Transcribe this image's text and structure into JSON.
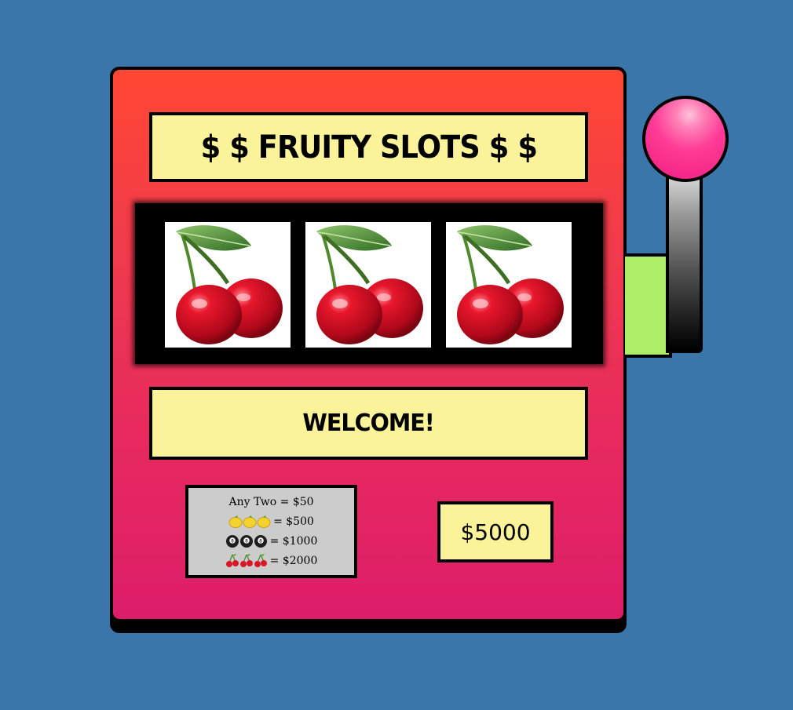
{
  "title": "$ $ FRUITY SLOTS $ $",
  "reels": [
    {
      "symbol": "cherry-icon"
    },
    {
      "symbol": "cherry-icon"
    },
    {
      "symbol": "cherry-icon"
    }
  ],
  "message": "WELCOME!",
  "paytable": {
    "rows": [
      {
        "symbols": [],
        "label": "Any Two = $50"
      },
      {
        "symbols": [
          "lemon-icon",
          "lemon-icon",
          "lemon-icon"
        ],
        "label": "= $500"
      },
      {
        "symbols": [
          "eight-ball-icon",
          "eight-ball-icon",
          "eight-ball-icon"
        ],
        "label": "= $1000"
      },
      {
        "symbols": [
          "cherry-icon",
          "cherry-icon",
          "cherry-icon"
        ],
        "label": "= $2000"
      }
    ]
  },
  "credits": "$5000",
  "colors": {
    "background": "#3A76A9",
    "machine_top": "#FF4733",
    "machine_bottom": "#DE1D6A",
    "panel": "#FBF399",
    "paytable": "#CCCCCC",
    "lever_base": "#AEEE66",
    "knob": "#FF3C97"
  }
}
